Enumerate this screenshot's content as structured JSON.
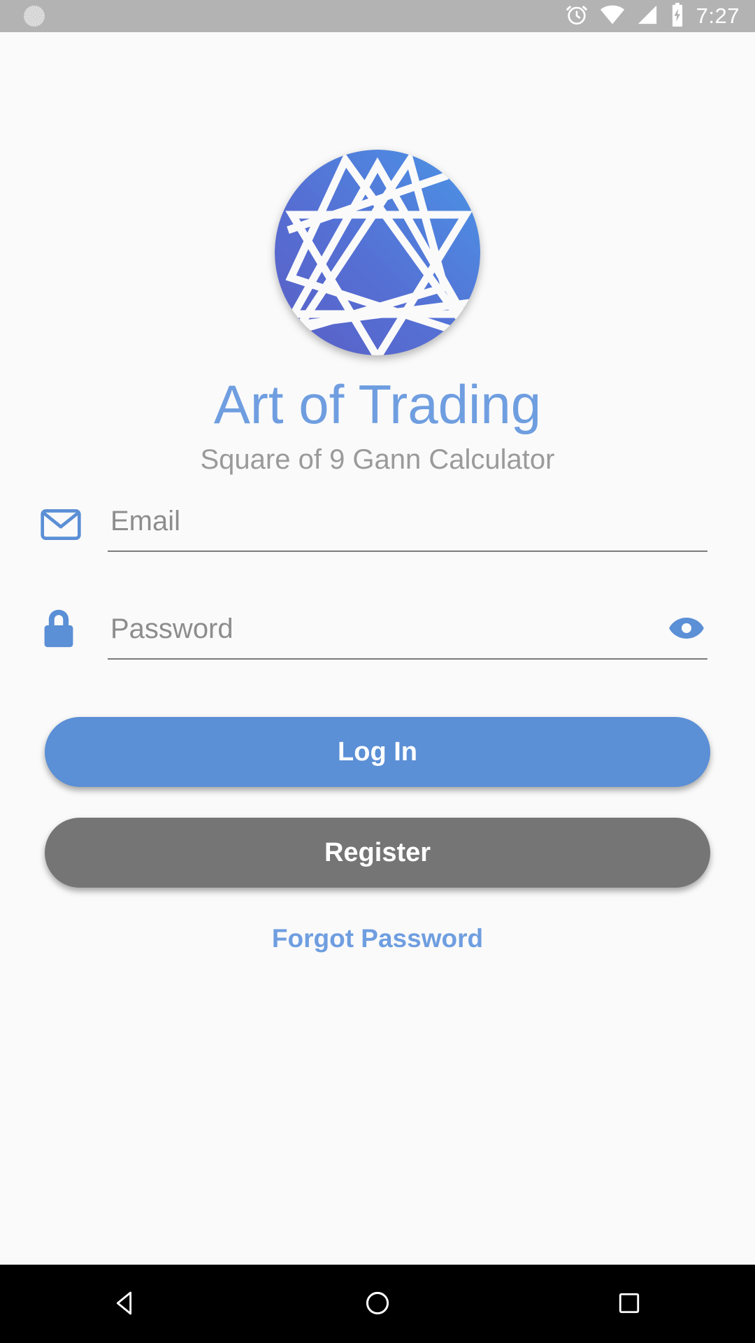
{
  "status_bar": {
    "background_color": "#b3b3b3",
    "left_icons": [
      {
        "name": "app-notification-icon",
        "glyph": "circle-hatched"
      }
    ],
    "right_icons": [
      {
        "name": "alarm-clock-icon"
      },
      {
        "name": "wifi-icon"
      },
      {
        "name": "cellular-signal-icon"
      },
      {
        "name": "battery-charging-icon"
      }
    ],
    "time": "7:27"
  },
  "branding": {
    "logo_name": "art-of-trading-logo",
    "logo_colors": {
      "from": "#5a63c8",
      "to": "#4b92e3"
    },
    "title": "Art of Trading",
    "title_color": "#6f9ee0",
    "subtitle": "Square of 9 Gann Calculator",
    "subtitle_color": "#9a9a9a"
  },
  "form": {
    "email": {
      "icon": "envelope-icon",
      "icon_color": "#5b8fd6",
      "placeholder": "Email",
      "value": ""
    },
    "password": {
      "icon": "lock-icon",
      "icon_color": "#5b8fd6",
      "placeholder": "Password",
      "value": "",
      "toggle_icon": "eye-icon",
      "toggle_icon_color": "#5b8fd6"
    }
  },
  "actions": {
    "login_label": "Log In",
    "login_color": "#5b8fd6",
    "register_label": "Register",
    "register_color": "#757575",
    "forgot_label": "Forgot Password",
    "forgot_color": "#6f9ee0"
  },
  "nav_bar": {
    "background_color": "#000000",
    "buttons": [
      {
        "name": "back-button",
        "glyph": "triangle-left"
      },
      {
        "name": "home-button",
        "glyph": "circle"
      },
      {
        "name": "recents-button",
        "glyph": "square"
      }
    ]
  }
}
